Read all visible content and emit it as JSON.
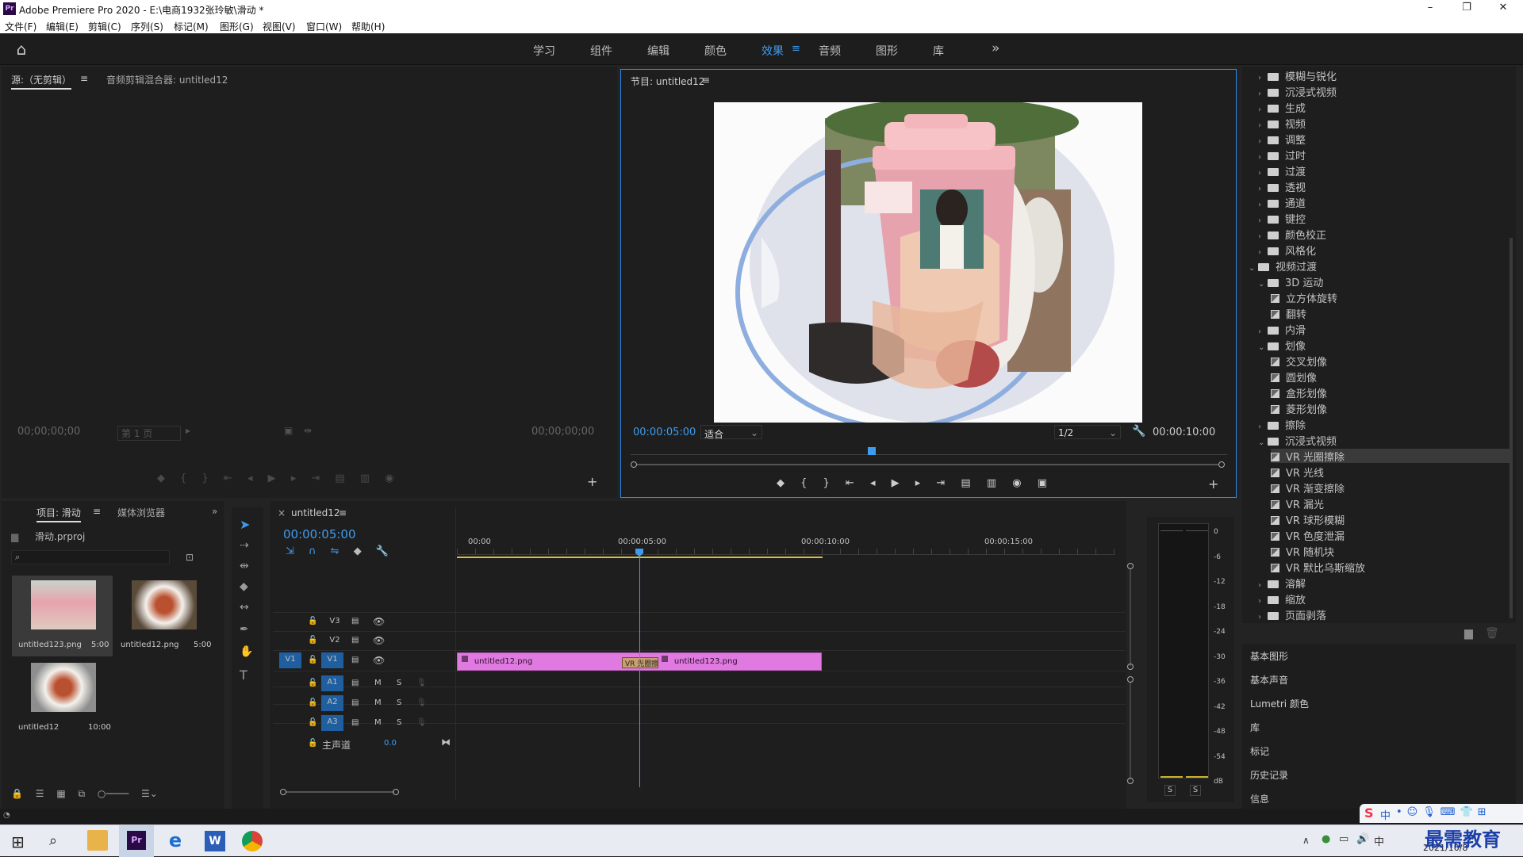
{
  "window": {
    "title": "Adobe Premiere Pro 2020 - E:\\电商1932张玲敏\\滑动 *",
    "app_badge": "Pr",
    "minimize": "–",
    "maximize": "❐",
    "close": "✕"
  },
  "menu": [
    "文件(F)",
    "编辑(E)",
    "剪辑(C)",
    "序列(S)",
    "标记(M)",
    "图形(G)",
    "视图(V)",
    "窗口(W)",
    "帮助(H)"
  ],
  "workspaces": {
    "items": [
      "学习",
      "组件",
      "编辑",
      "颜色",
      "效果",
      "音频",
      "图形",
      "库"
    ],
    "active": "效果",
    "more": "»"
  },
  "source_panel": {
    "tab": "源:（无剪辑）",
    "tab2": "音频剪辑混合器: untitled12",
    "tc_left": "00;00;00;00",
    "page": "第 1 页",
    "tc_right": "00;00;00;00"
  },
  "program_panel": {
    "tab": "节目: untitled12",
    "tc_current": "00:00:05:00",
    "fit": "适合",
    "resolution": "1/2",
    "tc_duration": "00:00:10:00"
  },
  "project_panel": {
    "tab": "项目: 滑动",
    "tab2": "媒体浏览器",
    "file": "滑动.prproj",
    "items": [
      {
        "name": "untitled123.png",
        "dur": "5:00"
      },
      {
        "name": "untitled12.png",
        "dur": "5:00"
      },
      {
        "name": "untitled12",
        "dur": "10:00"
      }
    ]
  },
  "timeline": {
    "tab": "untitled12",
    "tc": "00:00:05:00",
    "ruler": [
      "00:00",
      "00:00:05:00",
      "00:00:10:00",
      "00:00:15:00"
    ],
    "tracks_v": [
      "V3",
      "V2",
      "V1"
    ],
    "src_v1": "V1",
    "tracks_a": [
      "A1",
      "A2",
      "A3"
    ],
    "master": "主声道",
    "master_val": "0.0",
    "mute": "M",
    "solo": "S",
    "clip1": "untitled12.png",
    "clip2": "untitled123.png",
    "transition": "VR 光圈擦"
  },
  "meter": {
    "labels": [
      "0",
      "-6",
      "-12",
      "-18",
      "-24",
      "-30",
      "-36",
      "-42",
      "-48",
      "-54",
      "dB"
    ],
    "solo": [
      "S",
      "S"
    ]
  },
  "effects_tree": [
    {
      "label": "模糊与锐化",
      "type": "folder",
      "level": 1,
      "open": false
    },
    {
      "label": "沉浸式视频",
      "type": "folder",
      "level": 1,
      "open": false
    },
    {
      "label": "生成",
      "type": "folder",
      "level": 1,
      "open": false
    },
    {
      "label": "视频",
      "type": "folder",
      "level": 1,
      "open": false
    },
    {
      "label": "调整",
      "type": "folder",
      "level": 1,
      "open": false
    },
    {
      "label": "过时",
      "type": "folder",
      "level": 1,
      "open": false
    },
    {
      "label": "过渡",
      "type": "folder",
      "level": 1,
      "open": false
    },
    {
      "label": "透视",
      "type": "folder",
      "level": 1,
      "open": false
    },
    {
      "label": "通道",
      "type": "folder",
      "level": 1,
      "open": false
    },
    {
      "label": "键控",
      "type": "folder",
      "level": 1,
      "open": false
    },
    {
      "label": "颜色校正",
      "type": "folder",
      "level": 1,
      "open": false
    },
    {
      "label": "风格化",
      "type": "folder",
      "level": 1,
      "open": false
    },
    {
      "label": "视频过渡",
      "type": "folder",
      "level": 0,
      "open": true
    },
    {
      "label": "3D 运动",
      "type": "folder",
      "level": 1,
      "open": true
    },
    {
      "label": "立方体旋转",
      "type": "effect",
      "level": 2
    },
    {
      "label": "翻转",
      "type": "effect",
      "level": 2
    },
    {
      "label": "内滑",
      "type": "folder",
      "level": 1,
      "open": false
    },
    {
      "label": "划像",
      "type": "folder",
      "level": 1,
      "open": true
    },
    {
      "label": "交叉划像",
      "type": "effect",
      "level": 2
    },
    {
      "label": "圆划像",
      "type": "effect",
      "level": 2
    },
    {
      "label": "盒形划像",
      "type": "effect",
      "level": 2
    },
    {
      "label": "菱形划像",
      "type": "effect",
      "level": 2
    },
    {
      "label": "擦除",
      "type": "folder",
      "level": 1,
      "open": false
    },
    {
      "label": "沉浸式视频",
      "type": "folder",
      "level": 1,
      "open": true
    },
    {
      "label": "VR 光圈擦除",
      "type": "effect",
      "level": 2,
      "selected": true
    },
    {
      "label": "VR 光线",
      "type": "effect",
      "level": 2
    },
    {
      "label": "VR 渐变擦除",
      "type": "effect",
      "level": 2
    },
    {
      "label": "VR 漏光",
      "type": "effect",
      "level": 2
    },
    {
      "label": "VR 球形模糊",
      "type": "effect",
      "level": 2
    },
    {
      "label": "VR 色度泄漏",
      "type": "effect",
      "level": 2
    },
    {
      "label": "VR 随机块",
      "type": "effect",
      "level": 2
    },
    {
      "label": "VR 默比乌斯缩放",
      "type": "effect",
      "level": 2
    },
    {
      "label": "溶解",
      "type": "folder",
      "level": 1,
      "open": false
    },
    {
      "label": "缩放",
      "type": "folder",
      "level": 1,
      "open": false
    },
    {
      "label": "页面剥落",
      "type": "folder",
      "level": 1,
      "open": false
    }
  ],
  "side_panels": [
    "基本图形",
    "基本声音",
    "Lumetri 颜色",
    "库",
    "标记",
    "历史记录",
    "信息"
  ],
  "taskbar": {
    "date": "2021/10/8",
    "ime": "中",
    "brand": "最需教育"
  },
  "colors": {
    "accent": "#3e9cf0",
    "clip": "#e07ae0",
    "transition": "#c8a070",
    "playhead": "#3e9cf0"
  }
}
